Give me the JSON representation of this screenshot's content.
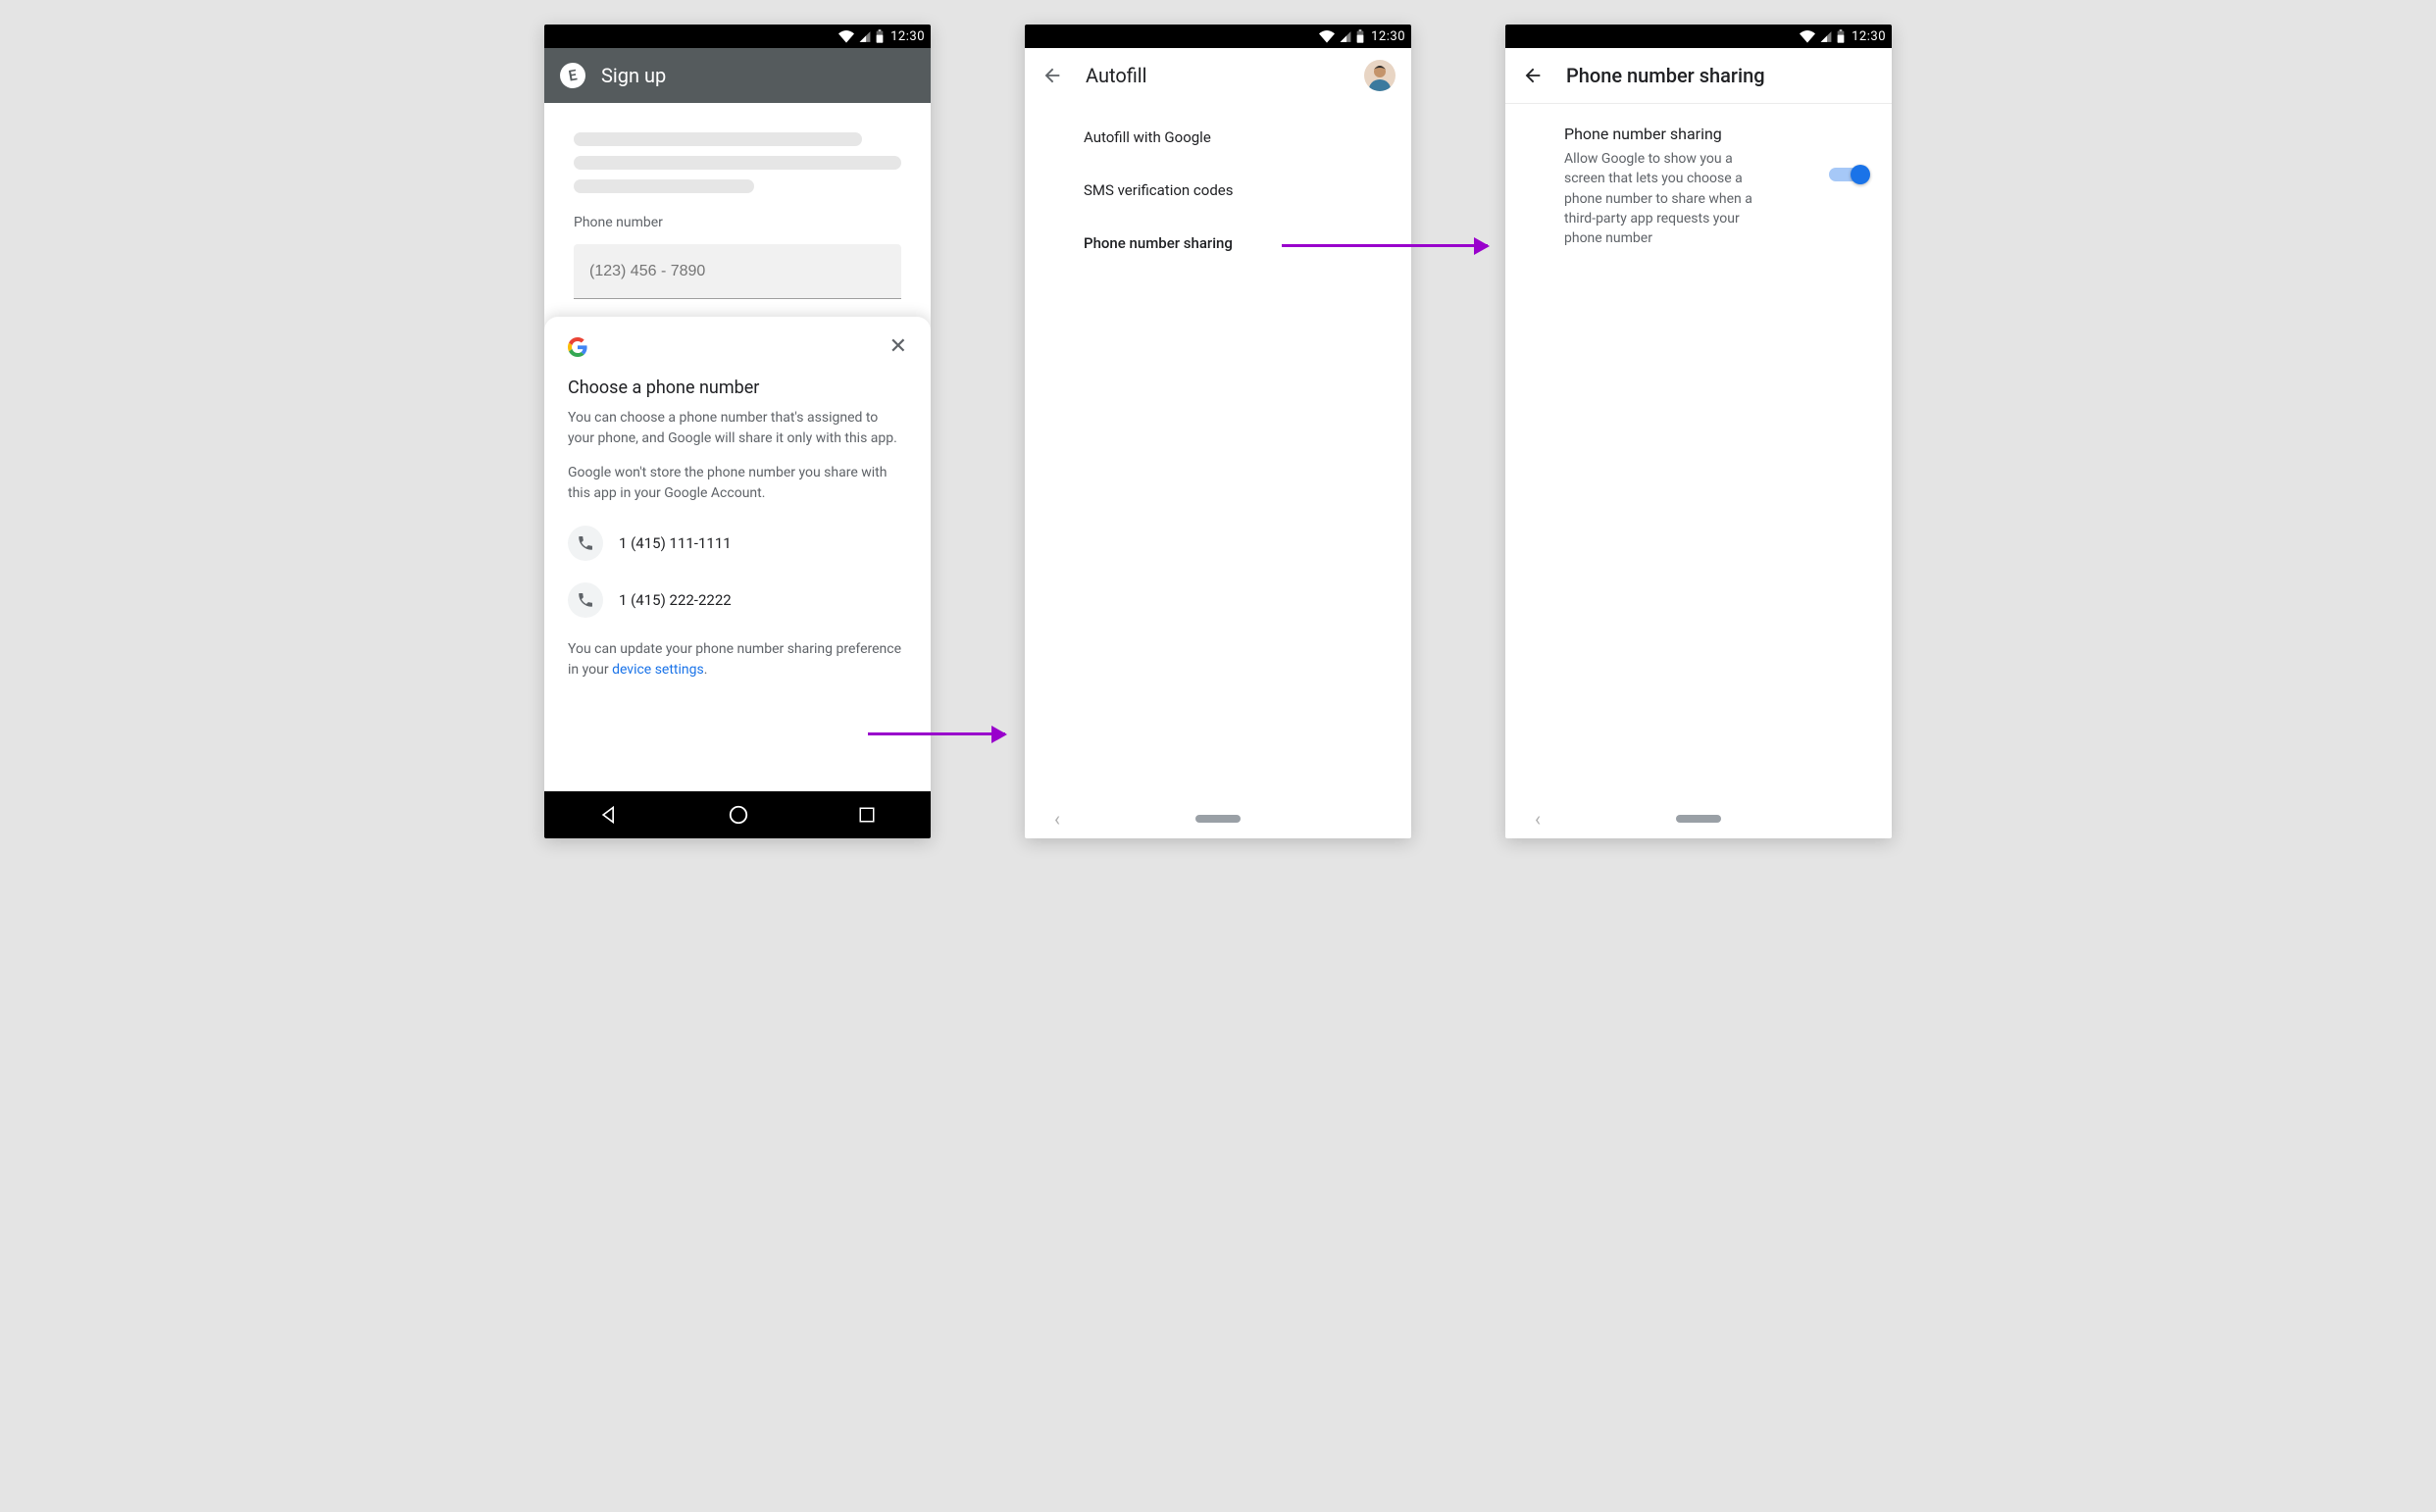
{
  "status": {
    "time": "12:30"
  },
  "screen1": {
    "appbar": {
      "logo_letter": "E",
      "title": "Sign up"
    },
    "form": {
      "field_label": "Phone number",
      "placeholder": "(123) 456 - 7890"
    },
    "sheet": {
      "heading": "Choose a phone number",
      "p1": "You can choose a phone number that's assigned to your phone, and Google will share it only with this app.",
      "p2": "Google won't store the phone number you share with this app in your Google Account.",
      "numbers": [
        "1 (415) 111-1111",
        "1 (415) 222-2222"
      ],
      "footnote_pre": "You can update your phone number sharing preference in your ",
      "footnote_link": "device settings",
      "footnote_post": "."
    }
  },
  "screen2": {
    "title": "Autofill",
    "items": [
      {
        "label": "Autofill with Google",
        "strong": false
      },
      {
        "label": "SMS verification codes",
        "strong": false
      },
      {
        "label": "Phone number sharing",
        "strong": true
      }
    ]
  },
  "screen3": {
    "title": "Phone number sharing",
    "setting_title": "Phone number sharing",
    "setting_desc": "Allow Google to show you a screen that lets you choose a phone number to share when a third-party app requests your phone number",
    "switch_on": true
  },
  "colors": {
    "arrow": "#9900cc",
    "link": "#1a73e8",
    "switch": "#1a73e8"
  }
}
